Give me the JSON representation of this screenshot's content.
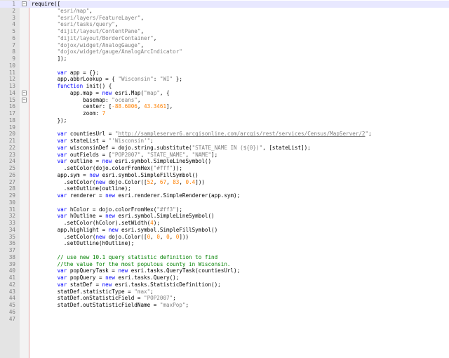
{
  "colors": {
    "keyword": "#0000ff",
    "string": "#808080",
    "number": "#ff8000",
    "comment": "#008000",
    "default": "#000000",
    "line_number": "#808080",
    "gutter": "#e4e4e4",
    "current_line": "#e8e8ff"
  },
  "fold_markers": {
    "1": "minus-box-icon",
    "14": "minus-box-icon",
    "15": "minus-box-icon"
  },
  "current_line": 1,
  "lines": [
    [
      [
        "t",
        "require(["
      ]
    ],
    [
      [
        "t",
        "        "
      ],
      [
        "s",
        "\"esri/map\""
      ],
      [
        "t",
        ","
      ]
    ],
    [
      [
        "t",
        "        "
      ],
      [
        "s",
        "\"esri/layers/FeatureLayer\""
      ],
      [
        "t",
        ","
      ]
    ],
    [
      [
        "t",
        "        "
      ],
      [
        "s",
        "\"esri/tasks/query\""
      ],
      [
        "t",
        ","
      ]
    ],
    [
      [
        "t",
        "        "
      ],
      [
        "s",
        "\"dijit/layout/ContentPane\""
      ],
      [
        "t",
        ","
      ]
    ],
    [
      [
        "t",
        "        "
      ],
      [
        "s",
        "\"dijit/layout/BorderContainer\""
      ],
      [
        "t",
        ","
      ]
    ],
    [
      [
        "t",
        "        "
      ],
      [
        "s",
        "\"dojox/widget/AnalogGauge\""
      ],
      [
        "t",
        ","
      ]
    ],
    [
      [
        "t",
        "        "
      ],
      [
        "s",
        "\"dojox/widget/gauge/AnalogArcIndicator\""
      ]
    ],
    [
      [
        "t",
        "        ]);"
      ]
    ],
    [],
    [
      [
        "t",
        "        "
      ],
      [
        "k",
        "var"
      ],
      [
        "t",
        " app = {};"
      ]
    ],
    [
      [
        "t",
        "        app.abbrLookup = { "
      ],
      [
        "s",
        "\"Wisconsin\""
      ],
      [
        "t",
        ": "
      ],
      [
        "s",
        "\"WI\""
      ],
      [
        "t",
        " };"
      ]
    ],
    [
      [
        "t",
        "        "
      ],
      [
        "k",
        "function"
      ],
      [
        "t",
        " init() {"
      ]
    ],
    [
      [
        "t",
        "            app.map = "
      ],
      [
        "k",
        "new"
      ],
      [
        "t",
        " esri.Map("
      ],
      [
        "s",
        "\"map\""
      ],
      [
        "t",
        ", {"
      ]
    ],
    [
      [
        "t",
        "                basemap: "
      ],
      [
        "s",
        "\"oceans\""
      ],
      [
        "t",
        ","
      ]
    ],
    [
      [
        "t",
        "                center: ["
      ],
      [
        "n",
        "-88.6006"
      ],
      [
        "t",
        ", "
      ],
      [
        "n",
        "43.3461"
      ],
      [
        "t",
        "],"
      ]
    ],
    [
      [
        "t",
        "                zoom: "
      ],
      [
        "n",
        "7"
      ]
    ],
    [
      [
        "t",
        "        });"
      ]
    ],
    [],
    [
      [
        "t",
        "        "
      ],
      [
        "k",
        "var"
      ],
      [
        "t",
        " countiesUrl = "
      ],
      [
        "s",
        "\""
      ],
      [
        "u",
        "http://sampleserver6.arcgisonline.com/arcgis/rest/services/Census/MapServer/2"
      ],
      [
        "s",
        "\""
      ],
      [
        "t",
        ";"
      ]
    ],
    [
      [
        "t",
        "        "
      ],
      [
        "k",
        "var"
      ],
      [
        "t",
        " stateList = "
      ],
      [
        "s",
        "\"'Wisconsin'\""
      ],
      [
        "t",
        ";"
      ]
    ],
    [
      [
        "t",
        "        "
      ],
      [
        "k",
        "var"
      ],
      [
        "t",
        " wisconsinDef = dojo.string.substitute("
      ],
      [
        "s",
        "\"STATE_NAME IN (${0})\""
      ],
      [
        "t",
        ", [stateList]);"
      ]
    ],
    [
      [
        "t",
        "        "
      ],
      [
        "k",
        "var"
      ],
      [
        "t",
        " outFields = ["
      ],
      [
        "s",
        "\"POP2007\""
      ],
      [
        "t",
        ", "
      ],
      [
        "s",
        "\"STATE_NAME\""
      ],
      [
        "t",
        ", "
      ],
      [
        "s",
        "\"NAME\""
      ],
      [
        "t",
        "];"
      ]
    ],
    [
      [
        "t",
        "        "
      ],
      [
        "k",
        "var"
      ],
      [
        "t",
        " outline = "
      ],
      [
        "k",
        "new"
      ],
      [
        "t",
        " esri.symbol.SimpleLineSymbol()"
      ]
    ],
    [
      [
        "t",
        "          .setColor(dojo.colorFromHex("
      ],
      [
        "s",
        "\"#fff\""
      ],
      [
        "t",
        "));"
      ]
    ],
    [
      [
        "t",
        "        app.sym = "
      ],
      [
        "k",
        "new"
      ],
      [
        "t",
        " esri.symbol.SimpleFillSymbol()"
      ]
    ],
    [
      [
        "t",
        "          .setColor("
      ],
      [
        "k",
        "new"
      ],
      [
        "t",
        " dojo.Color(["
      ],
      [
        "n",
        "52"
      ],
      [
        "t",
        ", "
      ],
      [
        "n",
        "67"
      ],
      [
        "t",
        ", "
      ],
      [
        "n",
        "83"
      ],
      [
        "t",
        ", "
      ],
      [
        "n",
        "0.4"
      ],
      [
        "t",
        "]))"
      ]
    ],
    [
      [
        "t",
        "          .setOutline(outline);"
      ]
    ],
    [
      [
        "t",
        "        "
      ],
      [
        "k",
        "var"
      ],
      [
        "t",
        " renderer = "
      ],
      [
        "k",
        "new"
      ],
      [
        "t",
        " esri.renderer.SimpleRenderer(app.sym);"
      ]
    ],
    [],
    [
      [
        "t",
        "        "
      ],
      [
        "k",
        "var"
      ],
      [
        "t",
        " hColor = dojo.colorFromHex("
      ],
      [
        "s",
        "\"#ff3\""
      ],
      [
        "t",
        ");"
      ]
    ],
    [
      [
        "t",
        "        "
      ],
      [
        "k",
        "var"
      ],
      [
        "t",
        " hOutline = "
      ],
      [
        "k",
        "new"
      ],
      [
        "t",
        " esri.symbol.SimpleLineSymbol()"
      ]
    ],
    [
      [
        "t",
        "          .setColor(hColor).setWidth("
      ],
      [
        "n",
        "4"
      ],
      [
        "t",
        ");"
      ]
    ],
    [
      [
        "t",
        "        app.highlight = "
      ],
      [
        "k",
        "new"
      ],
      [
        "t",
        " esri.symbol.SimpleFillSymbol()"
      ]
    ],
    [
      [
        "t",
        "          .setColor("
      ],
      [
        "k",
        "new"
      ],
      [
        "t",
        " dojo.Color(["
      ],
      [
        "n",
        "0"
      ],
      [
        "t",
        ", "
      ],
      [
        "n",
        "0"
      ],
      [
        "t",
        ", "
      ],
      [
        "n",
        "0"
      ],
      [
        "t",
        ", "
      ],
      [
        "n",
        "0"
      ],
      [
        "t",
        "]))"
      ]
    ],
    [
      [
        "t",
        "          .setOutline(hOutline);"
      ]
    ],
    [],
    [
      [
        "t",
        "        "
      ],
      [
        "c",
        "// use new 10.1 query statistic definition to find"
      ]
    ],
    [
      [
        "t",
        "        "
      ],
      [
        "c",
        "//the value for the most populous county in Wisconsin."
      ]
    ],
    [
      [
        "t",
        "        "
      ],
      [
        "k",
        "var"
      ],
      [
        "t",
        " popQueryTask = "
      ],
      [
        "k",
        "new"
      ],
      [
        "t",
        " esri.tasks.QueryTask(countiesUrl);"
      ]
    ],
    [
      [
        "t",
        "        "
      ],
      [
        "k",
        "var"
      ],
      [
        "t",
        " popQuery = "
      ],
      [
        "k",
        "new"
      ],
      [
        "t",
        " esri.tasks.Query();"
      ]
    ],
    [
      [
        "t",
        "        "
      ],
      [
        "k",
        "var"
      ],
      [
        "t",
        " statDef = "
      ],
      [
        "k",
        "new"
      ],
      [
        "t",
        " esri.tasks.StatisticDefinition();"
      ]
    ],
    [
      [
        "t",
        "        statDef.statisticType = "
      ],
      [
        "s",
        "\"max\""
      ],
      [
        "t",
        ";"
      ]
    ],
    [
      [
        "t",
        "        statDef.onStatisticField = "
      ],
      [
        "s",
        "\"POP2007\""
      ],
      [
        "t",
        ";"
      ]
    ],
    [
      [
        "t",
        "        statDef.outStatisticFieldName = "
      ],
      [
        "s",
        "\"maxPop\""
      ],
      [
        "t",
        ";"
      ]
    ],
    [],
    []
  ]
}
